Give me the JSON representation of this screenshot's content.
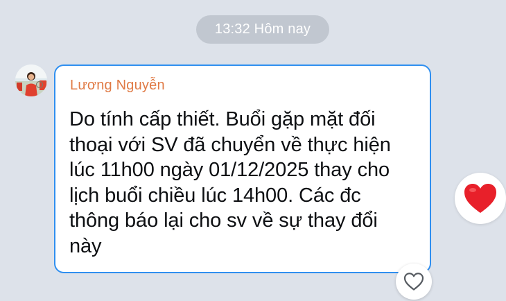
{
  "timestamp": "13:32 Hôm nay",
  "message": {
    "sender_name": "Lương Nguyễn",
    "text": "Do tính cấp thiết.  Buổi gặp mặt đối\nthoại với SV đã chuyển về thực hiện\nlúc 11h00 ngày 01/12/2025 thay cho\nlịch buổi chiều lúc 14h00. Các đc\nthông báo lại cho sv về sự thay đổi\nnày"
  },
  "icons": {
    "avatar": "user-avatar",
    "reaction": "red-heart-icon",
    "like": "heart-outline-icon"
  },
  "colors": {
    "background": "#dde2ea",
    "bubble_border": "#2f8ff0",
    "sender_name": "#e07a45",
    "heart": "#e8202a"
  }
}
